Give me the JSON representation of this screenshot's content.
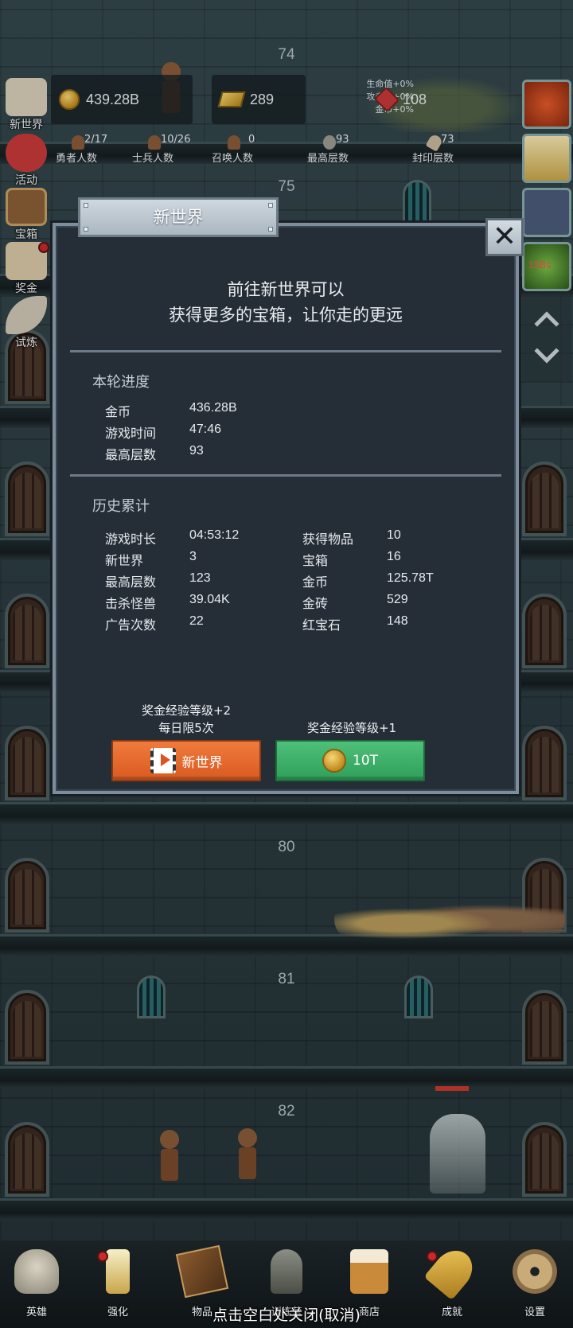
{
  "hud": {
    "coins": "439.28B",
    "gold_bricks": "289",
    "buffs": [
      "生命值+0%",
      "攻击力+0%",
      "金币+0%"
    ],
    "rubies": "108",
    "stats": [
      {
        "value": "2/17",
        "label": "勇者人数"
      },
      {
        "value": "10/26",
        "label": "士兵人数"
      },
      {
        "value": "0",
        "label": "召唤人数"
      },
      {
        "value": "93",
        "label": "最高层数"
      },
      {
        "value": "73",
        "label": "封印层数"
      }
    ]
  },
  "left_menu": [
    {
      "label": "新世界",
      "icon": "map-icon"
    },
    {
      "label": "活动",
      "icon": "heart-icon"
    },
    {
      "label": "宝箱",
      "icon": "chest-icon"
    },
    {
      "label": "奖金",
      "icon": "letter-icon"
    },
    {
      "label": "试炼",
      "icon": "feather-icon"
    }
  ],
  "right_menu": {
    "timer": "158s"
  },
  "floors": [
    "74",
    "75",
    "80",
    "81",
    "82"
  ],
  "dialog": {
    "title": "新世界",
    "intro_line1": "前往新世界可以",
    "intro_line2": "获得更多的宝箱，让你走的更远",
    "round": {
      "title": "本轮进度",
      "rows": [
        {
          "k": "金币",
          "v": "436.28B"
        },
        {
          "k": "游戏时间",
          "v": "47:46"
        },
        {
          "k": "最高层数",
          "v": "93"
        }
      ]
    },
    "history": {
      "title": "历史累计",
      "left": [
        {
          "k": "游戏时长",
          "v": "04:53:12"
        },
        {
          "k": "新世界",
          "v": "3"
        },
        {
          "k": "最高层数",
          "v": "123"
        },
        {
          "k": "击杀怪兽",
          "v": "39.04K"
        },
        {
          "k": "广告次数",
          "v": "22"
        }
      ],
      "right": [
        {
          "k": "获得物品",
          "v": "10"
        },
        {
          "k": "宝箱",
          "v": "16"
        },
        {
          "k": "金币",
          "v": "125.78T"
        },
        {
          "k": "金砖",
          "v": "529"
        },
        {
          "k": "红宝石",
          "v": "148"
        }
      ]
    },
    "ad_option": {
      "note_line1": "奖金经验等级+2",
      "note_line2": "每日限5次",
      "button": "新世界"
    },
    "coin_option": {
      "note": "奖金经验等级+1",
      "button": "10T"
    }
  },
  "bottom_nav": [
    {
      "label": "英雄",
      "icon": "skull-icon"
    },
    {
      "label": "强化",
      "icon": "candle-icon"
    },
    {
      "label": "物品",
      "icon": "book-icon"
    },
    {
      "label": "训练营",
      "icon": "lantern-icon"
    },
    {
      "label": "商店",
      "icon": "beer-icon"
    },
    {
      "label": "成就",
      "icon": "key-icon"
    },
    {
      "label": "设置",
      "icon": "gear-icon"
    }
  ],
  "close_hint": "点击空白处关闭(取消)",
  "colors": {
    "accent_orange": "#e0642a",
    "accent_green": "#3fb06a",
    "dialog_bg": "#252d37",
    "timer_red": "#ff4b4b"
  }
}
